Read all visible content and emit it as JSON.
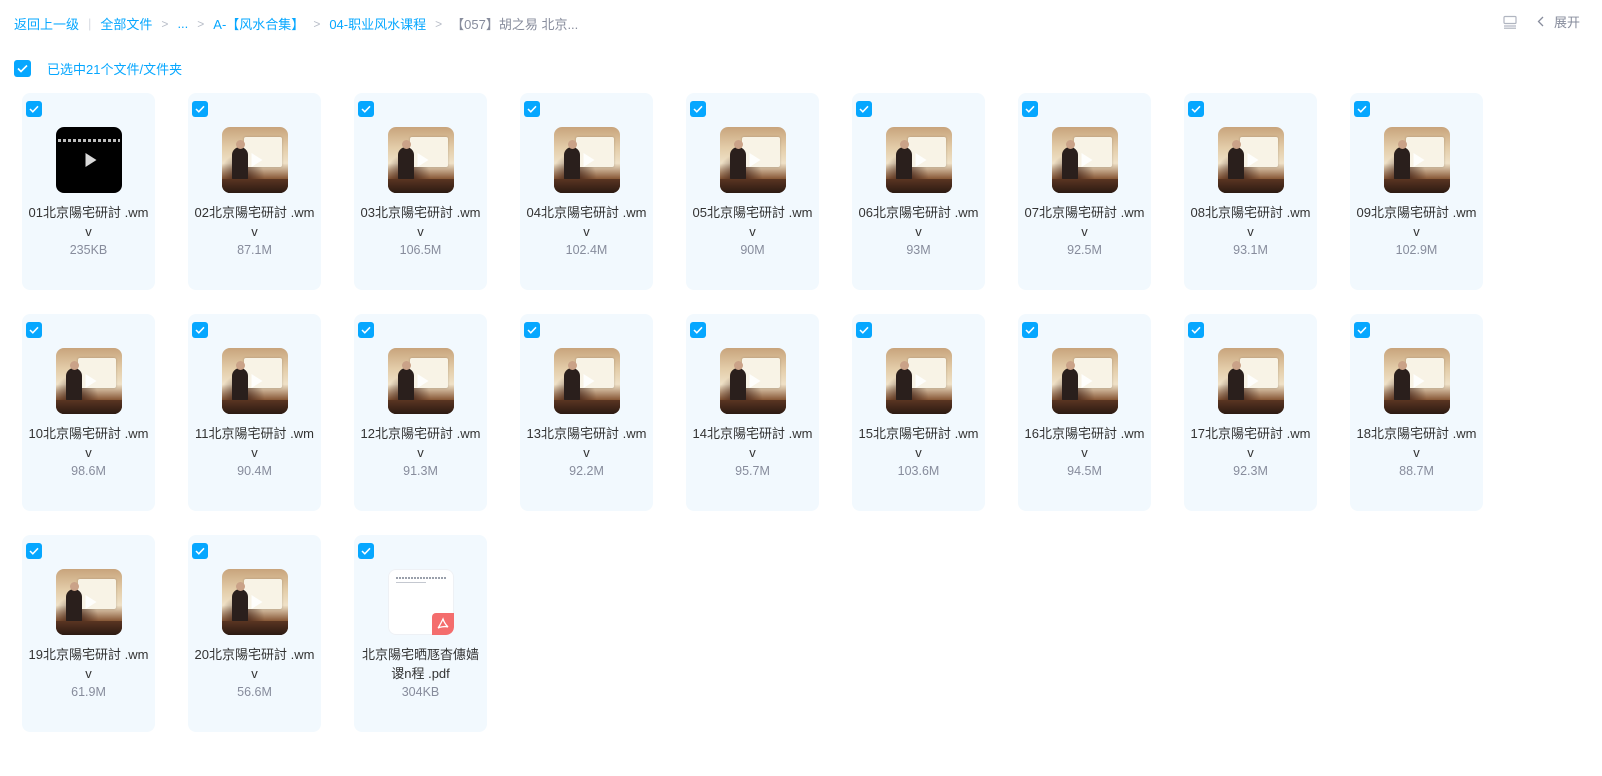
{
  "breadcrumb": {
    "back": "返回上一级",
    "items": [
      "全部文件",
      "...",
      "A-【风水合集】",
      "04-职业风水课程",
      "【057】胡之易 北京..."
    ],
    "separator": ">",
    "divider": "|"
  },
  "toolbar": {
    "list_icon": "list-view-icon",
    "expand_label": "展开"
  },
  "selection": {
    "label": "已选中21个文件/文件夹",
    "checked": true
  },
  "colors": {
    "accent": "#06a7ff",
    "card_bg": "#f2f9fe",
    "muted_text": "#878c9c",
    "pdf_red": "#f46d6d"
  },
  "files": [
    {
      "name": "01北京陽宅研討 .wmv",
      "size": "235KB",
      "type": "video-black"
    },
    {
      "name": "02北京陽宅研討 .wmv",
      "size": "87.1M",
      "type": "video"
    },
    {
      "name": "03北京陽宅研討 .wmv",
      "size": "106.5M",
      "type": "video"
    },
    {
      "name": "04北京陽宅研討 .wmv",
      "size": "102.4M",
      "type": "video"
    },
    {
      "name": "05北京陽宅研討 .wmv",
      "size": "90M",
      "type": "video"
    },
    {
      "name": "06北京陽宅研討 .wmv",
      "size": "93M",
      "type": "video"
    },
    {
      "name": "07北京陽宅研討 .wmv",
      "size": "92.5M",
      "type": "video"
    },
    {
      "name": "08北京陽宅研討 .wmv",
      "size": "93.1M",
      "type": "video"
    },
    {
      "name": "09北京陽宅研討 .wmv",
      "size": "102.9M",
      "type": "video"
    },
    {
      "name": "10北京陽宅研討 .wmv",
      "size": "98.6M",
      "type": "video"
    },
    {
      "name": "11北京陽宅研討 .wmv",
      "size": "90.4M",
      "type": "video"
    },
    {
      "name": "12北京陽宅研討 .wmv",
      "size": "91.3M",
      "type": "video"
    },
    {
      "name": "13北京陽宅研討 .wmv",
      "size": "92.2M",
      "type": "video"
    },
    {
      "name": "14北京陽宅研討 .wmv",
      "size": "95.7M",
      "type": "video"
    },
    {
      "name": "15北京陽宅研討 .wmv",
      "size": "103.6M",
      "type": "video"
    },
    {
      "name": "16北京陽宅研討 .wmv",
      "size": "94.5M",
      "type": "video"
    },
    {
      "name": "17北京陽宅研討 .wmv",
      "size": "92.3M",
      "type": "video"
    },
    {
      "name": "18北京陽宅研討 .wmv",
      "size": "88.7M",
      "type": "video"
    },
    {
      "name": "19北京陽宅研討 .wmv",
      "size": "61.9M",
      "type": "video"
    },
    {
      "name": "20北京陽宅研討 .wmv",
      "size": "56.6M",
      "type": "video"
    },
    {
      "name": "北京陽宅晒豗杳僡嫱谡n程 .pdf",
      "size": "304KB",
      "type": "pdf"
    }
  ]
}
